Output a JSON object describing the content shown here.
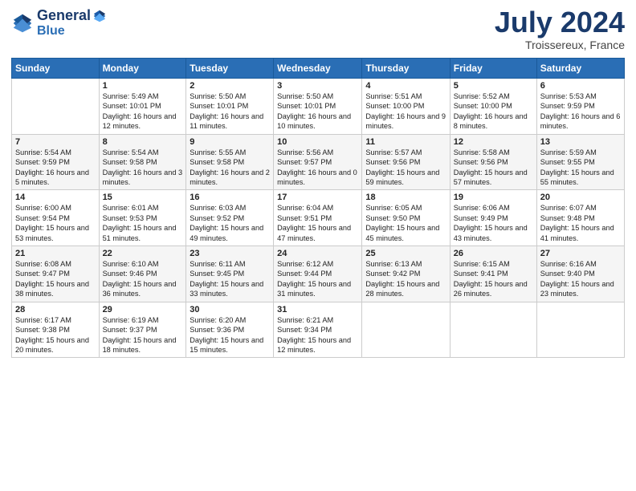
{
  "header": {
    "logo_line1": "General",
    "logo_line2": "Blue",
    "month": "July 2024",
    "location": "Troissereux, France"
  },
  "columns": [
    "Sunday",
    "Monday",
    "Tuesday",
    "Wednesday",
    "Thursday",
    "Friday",
    "Saturday"
  ],
  "weeks": [
    [
      {
        "day": "",
        "content": ""
      },
      {
        "day": "1",
        "content": "Sunrise: 5:49 AM\nSunset: 10:01 PM\nDaylight: 16 hours\nand 12 minutes."
      },
      {
        "day": "2",
        "content": "Sunrise: 5:50 AM\nSunset: 10:01 PM\nDaylight: 16 hours\nand 11 minutes."
      },
      {
        "day": "3",
        "content": "Sunrise: 5:50 AM\nSunset: 10:01 PM\nDaylight: 16 hours\nand 10 minutes."
      },
      {
        "day": "4",
        "content": "Sunrise: 5:51 AM\nSunset: 10:00 PM\nDaylight: 16 hours\nand 9 minutes."
      },
      {
        "day": "5",
        "content": "Sunrise: 5:52 AM\nSunset: 10:00 PM\nDaylight: 16 hours\nand 8 minutes."
      },
      {
        "day": "6",
        "content": "Sunrise: 5:53 AM\nSunset: 9:59 PM\nDaylight: 16 hours\nand 6 minutes."
      }
    ],
    [
      {
        "day": "7",
        "content": "Sunrise: 5:54 AM\nSunset: 9:59 PM\nDaylight: 16 hours\nand 5 minutes."
      },
      {
        "day": "8",
        "content": "Sunrise: 5:54 AM\nSunset: 9:58 PM\nDaylight: 16 hours\nand 3 minutes."
      },
      {
        "day": "9",
        "content": "Sunrise: 5:55 AM\nSunset: 9:58 PM\nDaylight: 16 hours\nand 2 minutes."
      },
      {
        "day": "10",
        "content": "Sunrise: 5:56 AM\nSunset: 9:57 PM\nDaylight: 16 hours\nand 0 minutes."
      },
      {
        "day": "11",
        "content": "Sunrise: 5:57 AM\nSunset: 9:56 PM\nDaylight: 15 hours\nand 59 minutes."
      },
      {
        "day": "12",
        "content": "Sunrise: 5:58 AM\nSunset: 9:56 PM\nDaylight: 15 hours\nand 57 minutes."
      },
      {
        "day": "13",
        "content": "Sunrise: 5:59 AM\nSunset: 9:55 PM\nDaylight: 15 hours\nand 55 minutes."
      }
    ],
    [
      {
        "day": "14",
        "content": "Sunrise: 6:00 AM\nSunset: 9:54 PM\nDaylight: 15 hours\nand 53 minutes."
      },
      {
        "day": "15",
        "content": "Sunrise: 6:01 AM\nSunset: 9:53 PM\nDaylight: 15 hours\nand 51 minutes."
      },
      {
        "day": "16",
        "content": "Sunrise: 6:03 AM\nSunset: 9:52 PM\nDaylight: 15 hours\nand 49 minutes."
      },
      {
        "day": "17",
        "content": "Sunrise: 6:04 AM\nSunset: 9:51 PM\nDaylight: 15 hours\nand 47 minutes."
      },
      {
        "day": "18",
        "content": "Sunrise: 6:05 AM\nSunset: 9:50 PM\nDaylight: 15 hours\nand 45 minutes."
      },
      {
        "day": "19",
        "content": "Sunrise: 6:06 AM\nSunset: 9:49 PM\nDaylight: 15 hours\nand 43 minutes."
      },
      {
        "day": "20",
        "content": "Sunrise: 6:07 AM\nSunset: 9:48 PM\nDaylight: 15 hours\nand 41 minutes."
      }
    ],
    [
      {
        "day": "21",
        "content": "Sunrise: 6:08 AM\nSunset: 9:47 PM\nDaylight: 15 hours\nand 38 minutes."
      },
      {
        "day": "22",
        "content": "Sunrise: 6:10 AM\nSunset: 9:46 PM\nDaylight: 15 hours\nand 36 minutes."
      },
      {
        "day": "23",
        "content": "Sunrise: 6:11 AM\nSunset: 9:45 PM\nDaylight: 15 hours\nand 33 minutes."
      },
      {
        "day": "24",
        "content": "Sunrise: 6:12 AM\nSunset: 9:44 PM\nDaylight: 15 hours\nand 31 minutes."
      },
      {
        "day": "25",
        "content": "Sunrise: 6:13 AM\nSunset: 9:42 PM\nDaylight: 15 hours\nand 28 minutes."
      },
      {
        "day": "26",
        "content": "Sunrise: 6:15 AM\nSunset: 9:41 PM\nDaylight: 15 hours\nand 26 minutes."
      },
      {
        "day": "27",
        "content": "Sunrise: 6:16 AM\nSunset: 9:40 PM\nDaylight: 15 hours\nand 23 minutes."
      }
    ],
    [
      {
        "day": "28",
        "content": "Sunrise: 6:17 AM\nSunset: 9:38 PM\nDaylight: 15 hours\nand 20 minutes."
      },
      {
        "day": "29",
        "content": "Sunrise: 6:19 AM\nSunset: 9:37 PM\nDaylight: 15 hours\nand 18 minutes."
      },
      {
        "day": "30",
        "content": "Sunrise: 6:20 AM\nSunset: 9:36 PM\nDaylight: 15 hours\nand 15 minutes."
      },
      {
        "day": "31",
        "content": "Sunrise: 6:21 AM\nSunset: 9:34 PM\nDaylight: 15 hours\nand 12 minutes."
      },
      {
        "day": "",
        "content": ""
      },
      {
        "day": "",
        "content": ""
      },
      {
        "day": "",
        "content": ""
      }
    ]
  ]
}
